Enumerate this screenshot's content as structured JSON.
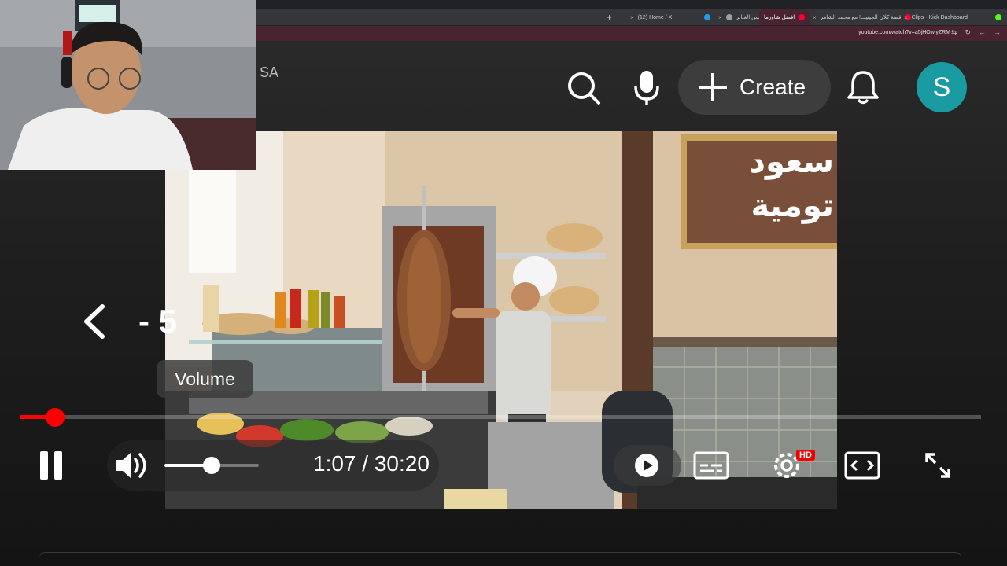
{
  "browser": {
    "tabs": [
      {
        "label": "(12) Home / X",
        "favicon_color": "#1d9bf0",
        "active": false
      },
      {
        "label": "حسن الغنابر",
        "favicon_color": "#9aa0a6",
        "active": false
      },
      {
        "label": "افضل شاورما",
        "favicon_color": "#ff0033",
        "active": true
      },
      {
        "label": "قصة كلان الجيتيت! مع محمد الشاهر",
        "favicon_color": "#ff0033",
        "active": false
      },
      {
        "label": "Clips - Kick Dashboard",
        "favicon_color": "#53fc18",
        "active": false
      }
    ],
    "url": "youtube.com/watch?v=a5jHOwlyZRM",
    "accent": "#4a2330"
  },
  "header": {
    "region_label": "SA",
    "search_icon": "search-icon",
    "mic_icon": "mic-icon",
    "create_label": "Create",
    "notifications_icon": "bell-icon",
    "avatar_letter": "S",
    "avatar_color": "#1a9ba1"
  },
  "video": {
    "sign_line1": "سعود",
    "sign_line2": "تومية"
  },
  "player": {
    "seek_back_value": "- 5",
    "tooltip": "Volume",
    "time_display": "1:07 / 30:20",
    "progress_fraction": 0.037,
    "volume_fraction": 0.5,
    "hd_badge": "HD",
    "progress_color": "#ff0000"
  }
}
